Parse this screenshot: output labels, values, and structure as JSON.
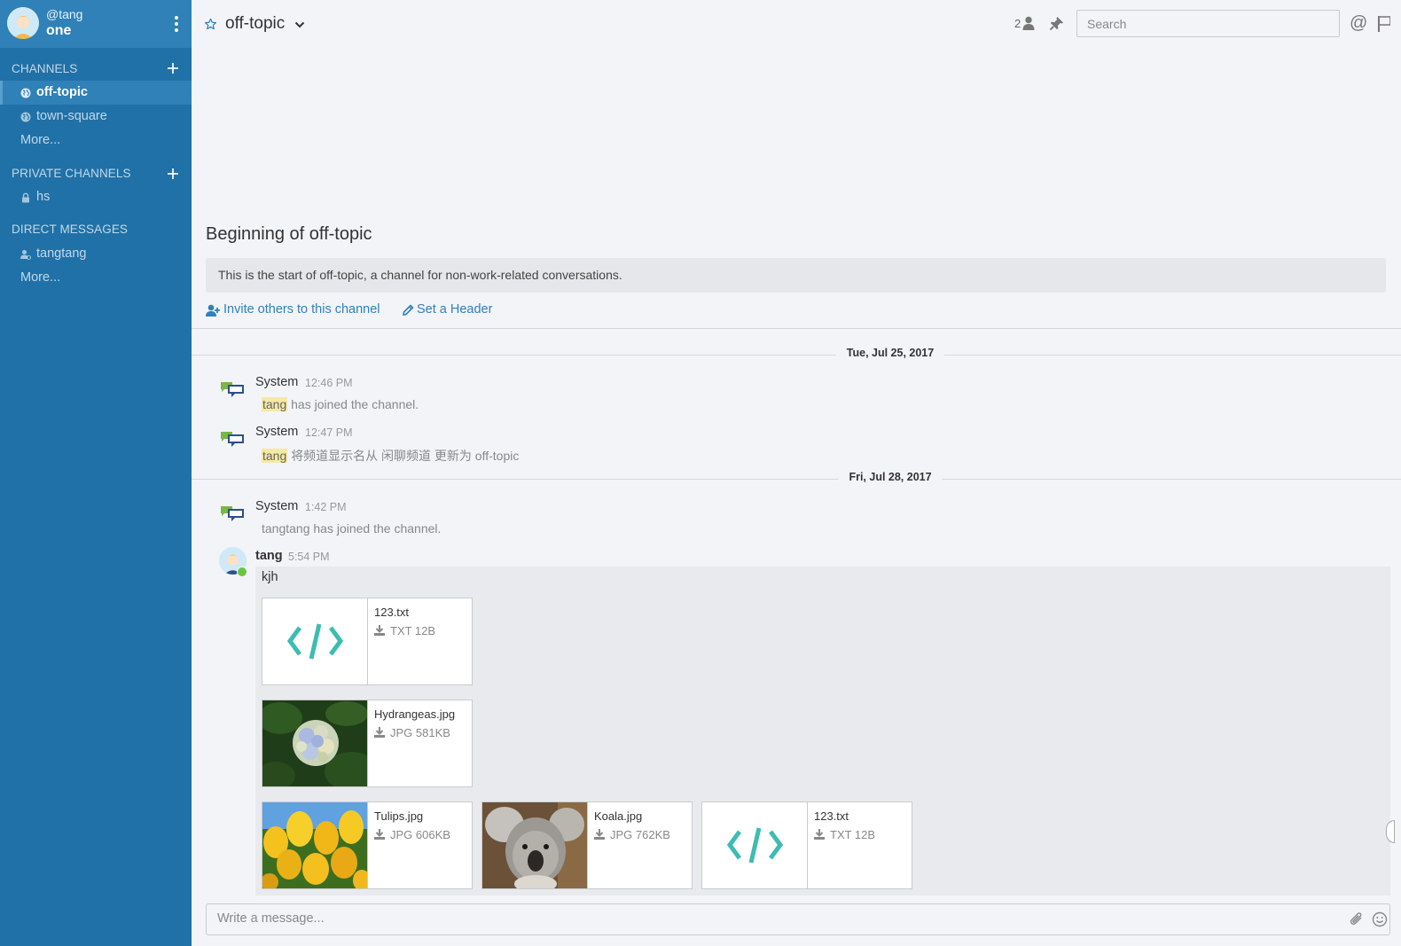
{
  "team": {
    "username": "@tang",
    "name": "one"
  },
  "sidebar": {
    "channels_title": "CHANNELS",
    "channels": [
      {
        "label": "off-topic",
        "icon": "globe-icon",
        "active": true
      },
      {
        "label": "town-square",
        "icon": "globe-icon",
        "active": false
      }
    ],
    "channels_more": "More...",
    "private_title": "PRIVATE CHANNELS",
    "private_channels": [
      {
        "label": "hs",
        "icon": "lock-icon"
      }
    ],
    "dm_title": "DIRECT MESSAGES",
    "direct_messages": [
      {
        "label": "tangtang",
        "icon": "user-offline-icon"
      }
    ],
    "dm_more": "More..."
  },
  "header": {
    "channel_name": "off-topic",
    "member_count": "2",
    "search_placeholder": "Search"
  },
  "intro": {
    "title": "Beginning of off-topic",
    "description": "This is the start of off-topic, a channel for non-work-related conversations.",
    "invite_link": "Invite others to this channel",
    "header_link": "Set a Header"
  },
  "dates": {
    "first": "Tue, Jul 25, 2017",
    "second": "Fri, Jul 28, 2017"
  },
  "posts": [
    {
      "user": "System",
      "time": "12:46 PM",
      "mention": "tang",
      "text": " has joined the channel."
    },
    {
      "user": "System",
      "time": "12:47 PM",
      "mention": "tang",
      "text": " 将频道显示名从 闲聊频道 更新为 off-topic"
    },
    {
      "user": "System",
      "time": "1:42 PM",
      "mention": "",
      "text": "tangtang has joined the channel."
    },
    {
      "user": "tang",
      "time": "5:54 PM",
      "mention": "",
      "text": "kjh"
    }
  ],
  "attachments": [
    {
      "name": "123.txt",
      "meta": "TXT 12B",
      "thumb": "code-icon"
    },
    {
      "name": "Hydrangeas.jpg",
      "meta": "JPG 581KB",
      "thumb": "hydrangea-image"
    },
    {
      "name": "Tulips.jpg",
      "meta": "JPG 606KB",
      "thumb": "tulips-image"
    },
    {
      "name": "Koala.jpg",
      "meta": "JPG 762KB",
      "thumb": "koala-image"
    },
    {
      "name": "123.txt",
      "meta": "TXT 12B",
      "thumb": "code-icon"
    }
  ],
  "composer": {
    "placeholder": "Write a message..."
  },
  "colors": {
    "sidebar_bg": "#2071a7",
    "sidebar_header": "#2f81b7",
    "link": "#2f81b7",
    "online": "#6ac33e",
    "code_icon": "#3dbcb2"
  }
}
